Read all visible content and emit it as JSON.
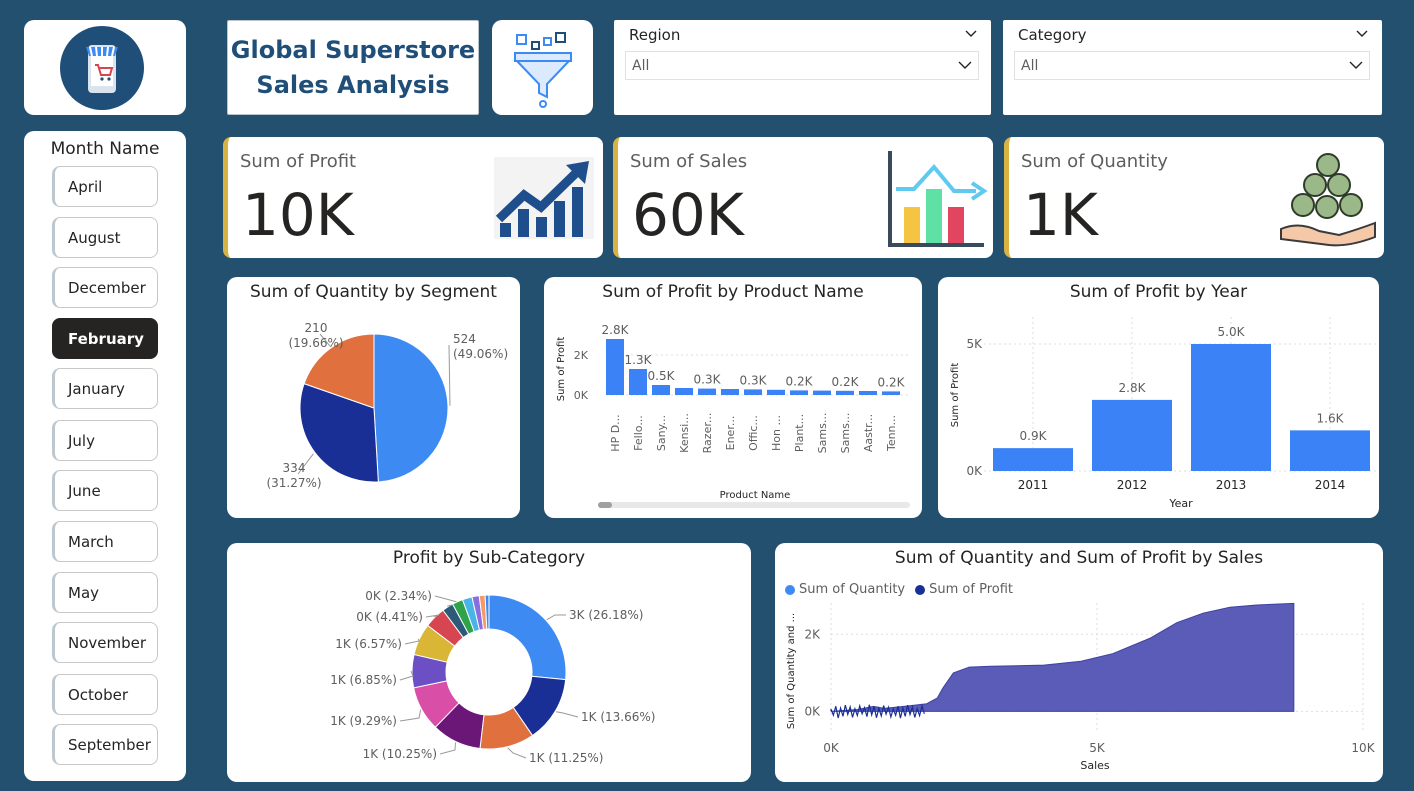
{
  "header": {
    "title_line1": "Global Superstore",
    "title_line2": "Sales Analysis"
  },
  "icons": {
    "logo": "mobile-shop-icon",
    "filter": "funnel-filter-icon",
    "profit": "trending-up-chart-icon",
    "sales": "bar-chart-icon",
    "quantity": "coins-hand-icon"
  },
  "filters": {
    "region": {
      "label": "Region",
      "value": "All"
    },
    "category": {
      "label": "Category",
      "value": "All"
    }
  },
  "month_slicer": {
    "title": "Month Name",
    "items": [
      "April",
      "August",
      "December",
      "February",
      "January",
      "July",
      "June",
      "March",
      "May",
      "November",
      "October",
      "September"
    ],
    "selected": "February"
  },
  "kpis": [
    {
      "label": "Sum of Profit",
      "value": "10K"
    },
    {
      "label": "Sum of Sales",
      "value": "60K"
    },
    {
      "label": "Sum of Quantity",
      "value": "1K"
    }
  ],
  "colors": {
    "accent": "#d8b243",
    "background": "#24506f",
    "bar": "#3b82f6",
    "area": "#5a5cb8"
  },
  "chart_data": [
    {
      "type": "pie",
      "title": "Sum of Quantity by Segment",
      "slices": [
        {
          "value": 524,
          "label": "524",
          "pct": "(49.06%)",
          "color": "#3d8bf2"
        },
        {
          "value": 334,
          "label": "334",
          "pct": "(31.27%)",
          "color": "#1a2f96"
        },
        {
          "value": 210,
          "label": "210",
          "pct": "(19.66%)",
          "color": "#e0713f"
        }
      ]
    },
    {
      "type": "bar",
      "title": "Sum of Profit by Product Name",
      "xlabel": "Product Name",
      "ylabel": "Sum of Profit",
      "ylim": [
        0,
        3000
      ],
      "yticks": [
        "0K",
        "2K"
      ],
      "categories": [
        "HP D...",
        "Fello...",
        "Sany...",
        "Kensi...",
        "Razer...",
        "Ener...",
        "Offic...",
        "Hon ...",
        "Plant...",
        "Sams...",
        "Sams...",
        "Aastr...",
        "Tenn..."
      ],
      "values": [
        2800,
        1300,
        500,
        350,
        320,
        300,
        280,
        260,
        230,
        220,
        210,
        200,
        180
      ],
      "labels": [
        "2.8K",
        "1.3K",
        "0.5K",
        "",
        "0.3K",
        "",
        "0.3K",
        "",
        "0.2K",
        "",
        "0.2K",
        "",
        "0.2K"
      ]
    },
    {
      "type": "bar",
      "title": "Sum of Profit by Year",
      "xlabel": "Year",
      "ylabel": "Sum of Profit",
      "ylim": [
        0,
        6000
      ],
      "yticks": [
        "0K",
        "5K"
      ],
      "categories": [
        "2011",
        "2012",
        "2013",
        "2014"
      ],
      "values": [
        900,
        2800,
        5000,
        1600
      ],
      "labels": [
        "0.9K",
        "2.8K",
        "5.0K",
        "1.6K"
      ]
    },
    {
      "type": "pie",
      "title": "Profit by Sub-Category",
      "slices": [
        {
          "value": 26.18,
          "label": "3K (26.18%)",
          "color": "#3d8bf2"
        },
        {
          "value": 13.66,
          "label": "1K (13.66%)",
          "color": "#1a2f96"
        },
        {
          "value": 11.25,
          "label": "1K (11.25%)",
          "color": "#e0713f"
        },
        {
          "value": 10.25,
          "label": "1K (10.25%)",
          "color": "#6b1778"
        },
        {
          "value": 9.29,
          "label": "1K (9.29%)",
          "color": "#d94fa7"
        },
        {
          "value": 6.85,
          "label": "1K (6.85%)",
          "color": "#6c4fc4"
        },
        {
          "value": 6.57,
          "label": "1K (6.57%)",
          "color": "#d9b636"
        },
        {
          "value": 4.41,
          "label": "0K (4.41%)",
          "color": "#d64550"
        },
        {
          "value": 2.34,
          "label": "0K (2.34%)",
          "color": "#2e5a7a"
        },
        {
          "value": 2.2,
          "label": "",
          "color": "#2ea34a"
        },
        {
          "value": 2.0,
          "label": "",
          "color": "#4bb4e6"
        },
        {
          "value": 1.5,
          "label": "",
          "color": "#8a6ee0"
        },
        {
          "value": 1.2,
          "label": "",
          "color": "#f29a6b"
        },
        {
          "value": 0.8,
          "label": "",
          "color": "#3d8bf2"
        }
      ]
    },
    {
      "type": "area",
      "title": "Sum of Quantity and Sum of Profit by Sales",
      "xlabel": "Sales",
      "ylabel": "Sum of Quantity and ...",
      "xlim": [
        0,
        10000
      ],
      "ylim": [
        -300,
        3200
      ],
      "xticks": [
        "0K",
        "5K",
        "10K"
      ],
      "yticks": [
        "0K",
        "2K"
      ],
      "legend_position": "top-left",
      "series": [
        {
          "name": "Sum of Quantity",
          "color": "#3d8bf2"
        },
        {
          "name": "Sum of Profit",
          "color": "#1a2f96"
        }
      ],
      "area_points": [
        [
          0,
          0
        ],
        [
          500,
          50
        ],
        [
          800,
          130
        ],
        [
          1000,
          80
        ],
        [
          1300,
          120
        ],
        [
          1500,
          150
        ],
        [
          1800,
          200
        ],
        [
          2000,
          350
        ],
        [
          2100,
          600
        ],
        [
          2300,
          1000
        ],
        [
          2600,
          1150
        ],
        [
          3000,
          1170
        ],
        [
          4000,
          1200
        ],
        [
          4700,
          1300
        ],
        [
          5300,
          1500
        ],
        [
          6000,
          1900
        ],
        [
          6500,
          2300
        ],
        [
          7000,
          2550
        ],
        [
          7500,
          2700
        ],
        [
          8000,
          2760
        ],
        [
          8700,
          2800
        ]
      ]
    }
  ]
}
